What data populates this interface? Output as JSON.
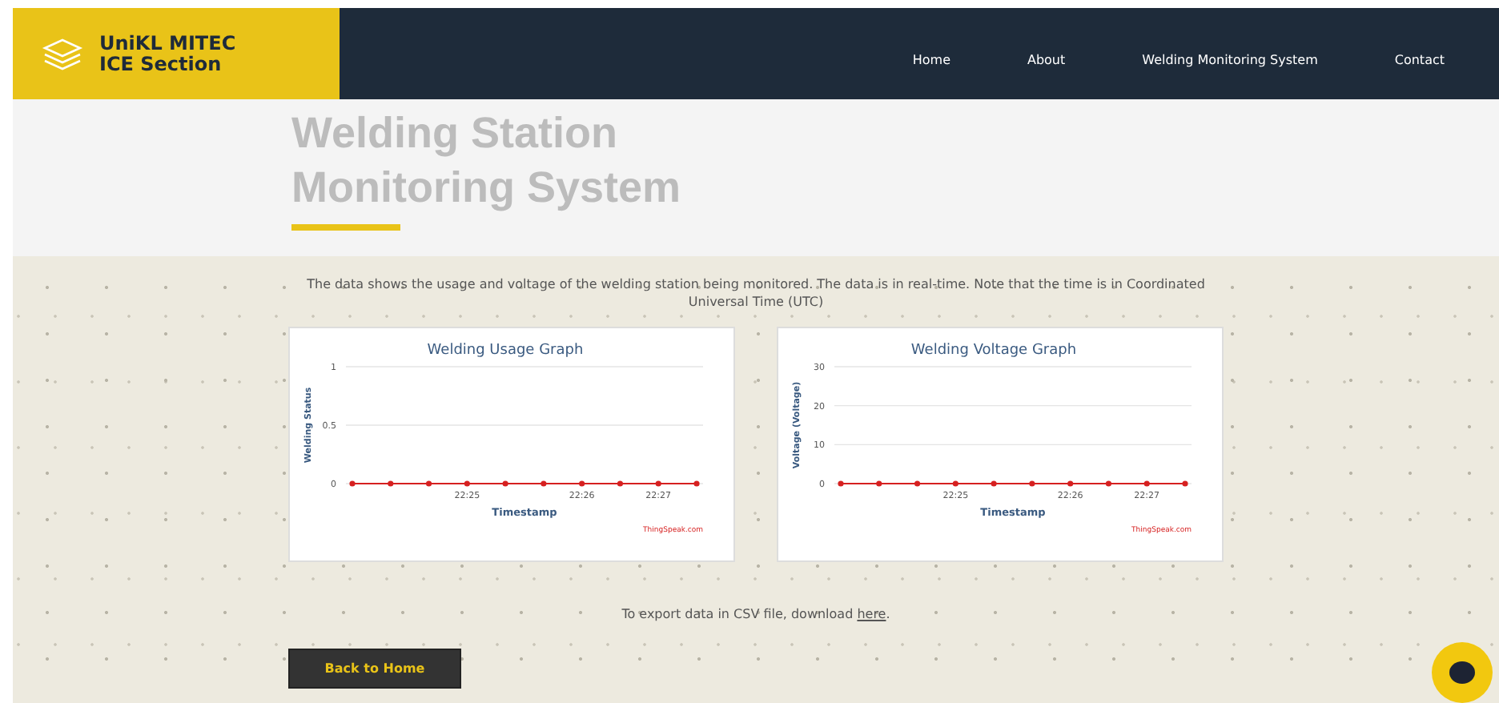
{
  "logo": {
    "line_1": "UniKL MITEC",
    "line_2": "ICE Section"
  },
  "nav": [
    {
      "label": "Home"
    },
    {
      "label": "About"
    },
    {
      "label": "Welding Monitoring System"
    },
    {
      "label": "Contact"
    }
  ],
  "page_title": {
    "line_1": "Welding Station",
    "line_2": "Monitoring System"
  },
  "intro": "The data shows the usage and voltage of the welding station being monitored. The data is in real-time. Note that the time is in Coordinated Universal Time (UTC)",
  "charts": [
    {
      "credit": "ThingSpeak.com",
      "chart_data": {
        "type": "line",
        "title": "Welding Usage Graph",
        "xlabel": "Timestamp",
        "ylabel": "Welding Status",
        "categories": [
          null,
          null,
          null,
          "22:25",
          null,
          null,
          "22:26",
          null,
          "22:27",
          null
        ],
        "series": [
          {
            "color": "#d62020",
            "marker": "circle",
            "values": [
              0,
              0,
              0,
              0,
              0,
              0,
              0,
              0,
              0,
              0
            ]
          }
        ],
        "ylim": [
          0,
          1
        ],
        "yticks": [
          0,
          0.5,
          1
        ]
      }
    },
    {
      "credit": "ThingSpeak.com",
      "chart_data": {
        "type": "line",
        "title": "Welding Voltage Graph",
        "xlabel": "Timestamp",
        "ylabel": "Voltage (Voltage)",
        "categories": [
          null,
          null,
          null,
          "22:25",
          null,
          null,
          "22:26",
          null,
          "22:27",
          null
        ],
        "series": [
          {
            "color": "#d62020",
            "marker": "circle",
            "values": [
              0,
              0,
              0,
              0,
              0,
              0,
              0,
              0,
              0,
              0
            ]
          }
        ],
        "ylim": [
          0,
          30
        ],
        "yticks": [
          0,
          10,
          20,
          30
        ]
      }
    }
  ],
  "export": {
    "text": "To export data in CSV file, download",
    "link": "here",
    "end": "."
  },
  "back_button": "Back to Home"
}
